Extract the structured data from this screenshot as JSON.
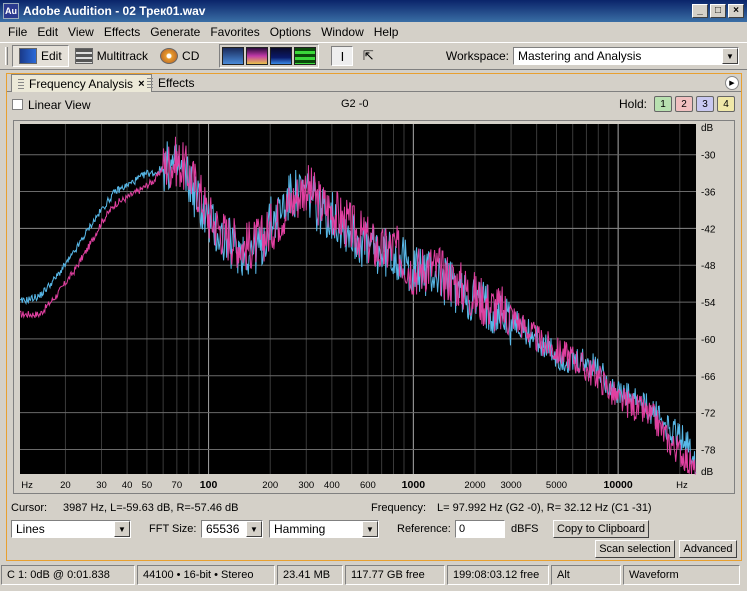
{
  "window": {
    "app_icon": "Au",
    "title": "Adobe Audition - 02 Трек01.wav"
  },
  "menu": [
    "File",
    "Edit",
    "View",
    "Effects",
    "Generate",
    "Favorites",
    "Options",
    "Window",
    "Help"
  ],
  "toolbar": {
    "edit_label": "Edit",
    "multitrack_label": "Multitrack",
    "cd_label": "CD",
    "workspace_label": "Workspace:",
    "workspace_value": "Mastering and Analysis"
  },
  "tabs": {
    "active": "Frequency Analysis",
    "other": "Effects"
  },
  "options": {
    "linear_view_label": "Linear View",
    "graph_label": "G2 -0",
    "hold_label": "Hold:",
    "hold_buttons": [
      "1",
      "2",
      "3",
      "4"
    ]
  },
  "chart_data": {
    "type": "line",
    "x_scale": "log",
    "xlim": [
      12,
      24000
    ],
    "ylim": [
      -82,
      -25
    ],
    "x_tick_labels": [
      "Hz",
      "20",
      "30",
      "40",
      "50",
      "70",
      "100",
      "200",
      "300",
      "400",
      "600",
      "1000",
      "2000",
      "3000",
      "5000",
      "10000",
      "Hz"
    ],
    "y_tick_labels": [
      "dB",
      "-30",
      "-36",
      "-42",
      "-48",
      "-54",
      "-60",
      "-66",
      "-72",
      "-78",
      "dB"
    ],
    "colors": {
      "background": "#000000",
      "grid": "#6a6a6a",
      "left": "#e040a0",
      "right": "#58b8e8"
    },
    "series": [
      {
        "channel": "L",
        "x": [
          12,
          15,
          18,
          22,
          26,
          30,
          35,
          40,
          45,
          50,
          55,
          60,
          70,
          80,
          90,
          100,
          120,
          150,
          180,
          200,
          250,
          300,
          350,
          400,
          500,
          600,
          700,
          800,
          1000,
          1200,
          1500,
          2000,
          2500,
          3000,
          4000,
          5000,
          6000,
          7000,
          8000,
          10000,
          12000,
          15000,
          18000,
          21000,
          24000
        ],
        "y": [
          -56,
          -56,
          -53,
          -49,
          -45,
          -41,
          -38,
          -37,
          -36,
          -35,
          -34,
          -32,
          -31,
          -33,
          -36,
          -40,
          -43,
          -45,
          -44,
          -42,
          -38,
          -35,
          -38,
          -39,
          -42,
          -44,
          -46,
          -45,
          -49,
          -48,
          -50,
          -53,
          -55,
          -56,
          -60,
          -62,
          -63,
          -65,
          -66,
          -70,
          -71,
          -73,
          -77,
          -79,
          -82
        ]
      },
      {
        "channel": "R",
        "x": [
          12,
          15,
          18,
          22,
          26,
          30,
          35,
          40,
          45,
          50,
          55,
          60,
          70,
          80,
          90,
          100,
          120,
          150,
          180,
          200,
          250,
          300,
          350,
          400,
          500,
          600,
          700,
          800,
          1000,
          1200,
          1500,
          2000,
          2500,
          3000,
          4000,
          5000,
          6000,
          7000,
          8000,
          10000,
          12000,
          15000,
          18000,
          21000,
          24000
        ],
        "y": [
          -54,
          -53,
          -50,
          -46,
          -42,
          -39,
          -36,
          -35,
          -34,
          -33,
          -33,
          -32,
          -32,
          -34,
          -38,
          -41,
          -44,
          -46,
          -45,
          -41,
          -37,
          -36,
          -39,
          -40,
          -43,
          -45,
          -46,
          -46,
          -49,
          -49,
          -51,
          -54,
          -55,
          -57,
          -60,
          -63,
          -64,
          -64,
          -65,
          -69,
          -70,
          -72,
          -75,
          -76,
          -80
        ]
      }
    ]
  },
  "readouts": {
    "cursor_label": "Cursor:",
    "cursor_value": "3987 Hz, L=-59.63 dB, R=-57.46 dB",
    "frequency_label": "Frequency:",
    "frequency_value": "L= 97.992 Hz (G2 -0), R= 32.12 Hz (C1 -31)"
  },
  "controls": {
    "display_mode": "Lines",
    "fft_label": "FFT Size:",
    "fft_value": "65536",
    "window_func": "Hamming",
    "reference_label": "Reference:",
    "reference_value": "0",
    "reference_unit": "dBFS",
    "copy_button": "Copy to Clipboard",
    "scan_button": "Scan selection",
    "advanced_button": "Advanced"
  },
  "statusbar": [
    "C   1: 0dB @ 0:01.838",
    "44100 • 16-bit • Stereo",
    "23.41 MB",
    "117.77 GB free",
    "199:08:03.12 free",
    "Alt",
    "Waveform"
  ]
}
